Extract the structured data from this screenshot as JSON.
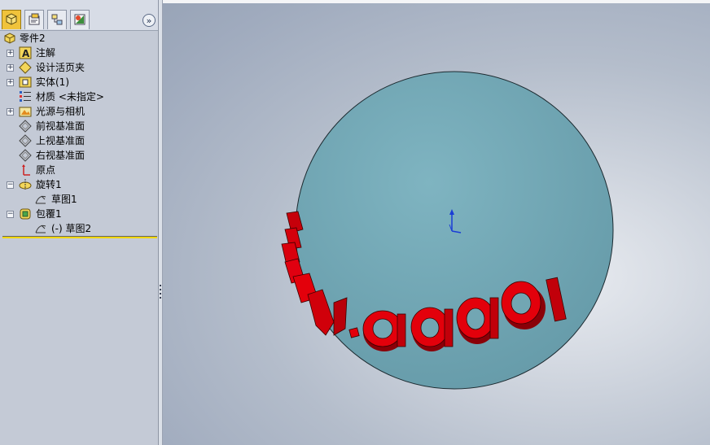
{
  "tabs": [
    {
      "name": "featuremanager",
      "icon": "featuremanager-tree-icon",
      "active": true
    },
    {
      "name": "propertymanager",
      "icon": "propertymanager-icon",
      "active": false
    },
    {
      "name": "configurationmanager",
      "icon": "configurationmanager-icon",
      "active": false
    },
    {
      "name": "displaymanager",
      "icon": "displaymanager-icon",
      "active": false
    }
  ],
  "collapse_button": "»",
  "tree": {
    "root": "零件2",
    "items": [
      {
        "label": "注解",
        "icon": "annotations-icon",
        "expander": "+"
      },
      {
        "label": "设计活页夹",
        "icon": "design-binder-icon",
        "expander": "+"
      },
      {
        "label": "实体(1)",
        "icon": "solid-bodies-icon",
        "expander": "+"
      },
      {
        "label": "材质 <未指定>",
        "icon": "material-icon",
        "expander": ""
      },
      {
        "label": "光源与相机",
        "icon": "lights-cameras-icon",
        "expander": "+"
      },
      {
        "label": "前视基准面",
        "icon": "plane-icon",
        "expander": ""
      },
      {
        "label": "上视基准面",
        "icon": "plane-icon",
        "expander": ""
      },
      {
        "label": "右视基准面",
        "icon": "plane-icon",
        "expander": ""
      },
      {
        "label": "原点",
        "icon": "origin-icon",
        "expander": ""
      },
      {
        "label": "旋转1",
        "icon": "revolve-feature-icon",
        "expander": "−"
      },
      {
        "label": "草图1",
        "icon": "sketch-icon",
        "expander": "",
        "child": true
      },
      {
        "label": "包覆1",
        "icon": "wrap-feature-icon",
        "expander": "−"
      },
      {
        "label": "(-) 草图2",
        "icon": "sketch-icon",
        "expander": "",
        "child": true
      }
    ]
  },
  "model": {
    "embossed_text": "aaaa",
    "sphere_color": "#72a6b3",
    "text_color": "#e3000b"
  }
}
